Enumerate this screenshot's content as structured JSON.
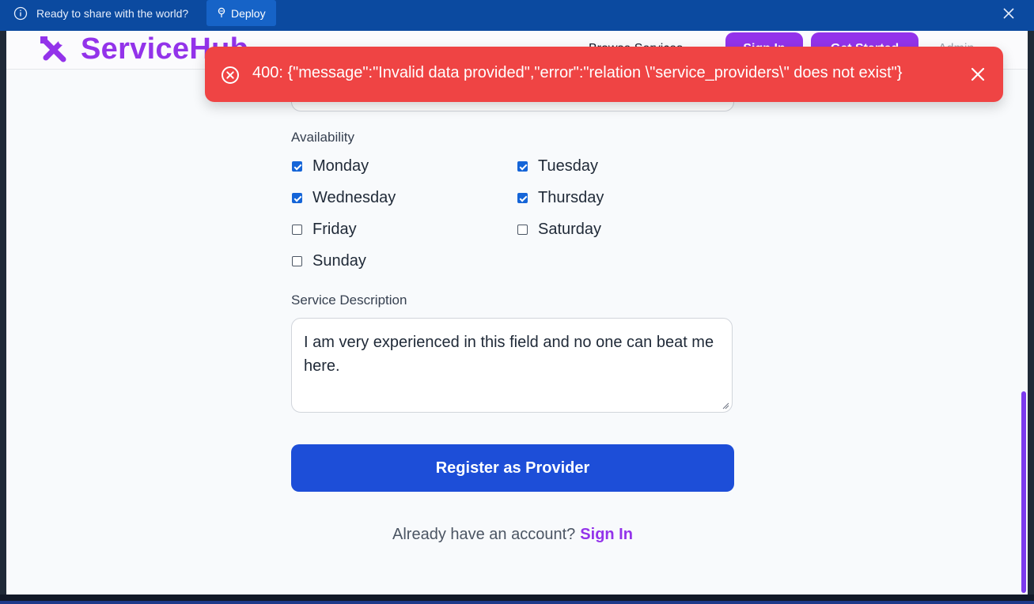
{
  "topbar": {
    "message": "Ready to share with the world?",
    "deploy_label": "Deploy"
  },
  "header": {
    "brand": "ServiceHub",
    "nav_partial": "Browse Services",
    "signin_label": "Sign In",
    "get_started_label": "Get Started",
    "admin_label": "Admin"
  },
  "form": {
    "availability_label": "Availability",
    "days": [
      {
        "label": "Monday",
        "checked": true
      },
      {
        "label": "Tuesday",
        "checked": true
      },
      {
        "label": "Wednesday",
        "checked": true
      },
      {
        "label": "Thursday",
        "checked": true
      },
      {
        "label": "Friday",
        "checked": false
      },
      {
        "label": "Saturday",
        "checked": false
      },
      {
        "label": "Sunday",
        "checked": false
      }
    ],
    "description_label": "Service Description",
    "description_value": "I am very experienced in this field and no one can beat me here.",
    "submit_label": "Register as Provider",
    "already_text": "Already have an account?",
    "signin_link": "Sign In"
  },
  "toast": {
    "message": "400: {\"message\":\"Invalid data provided\",\"error\":\"relation \\\"service_providers\\\" does not exist\"}"
  },
  "colors": {
    "brand": "#9333ea",
    "primary": "#1d4ed8",
    "error": "#ef4444",
    "topbar": "#0b4aa0"
  }
}
